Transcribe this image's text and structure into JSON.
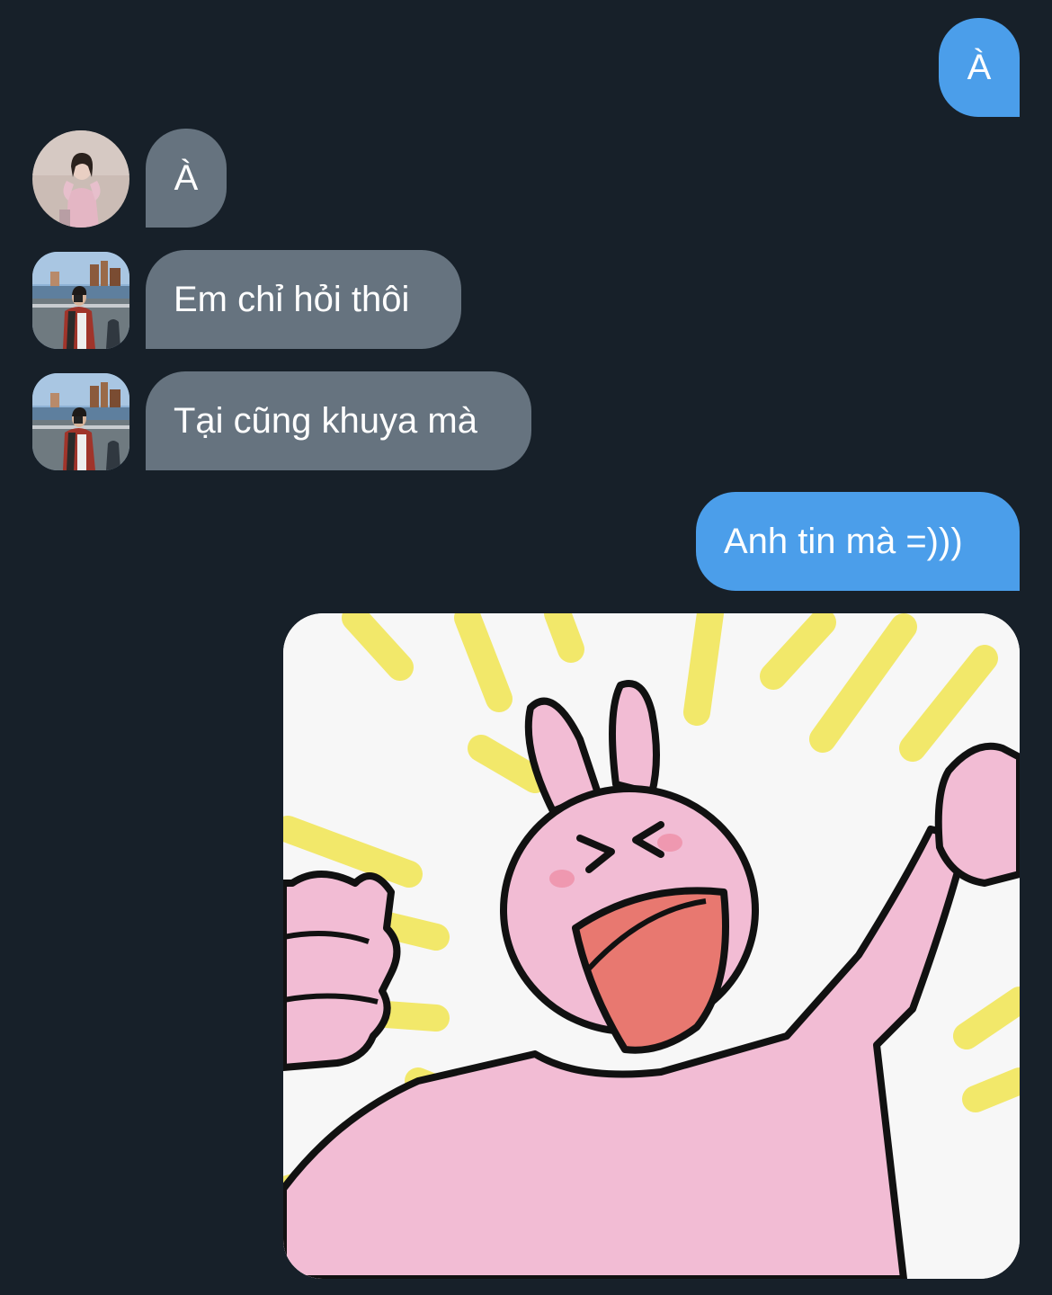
{
  "messages": [
    {
      "id": "m1",
      "direction": "outgoing",
      "text": "À"
    },
    {
      "id": "m2",
      "direction": "incoming",
      "text": "À",
      "avatar": "girl-avatar"
    },
    {
      "id": "m3",
      "direction": "incoming",
      "text": "Em chỉ hỏi thôi",
      "avatar": "boy-avatar"
    },
    {
      "id": "m4",
      "direction": "incoming",
      "text": "Tại cũng khuya mà",
      "avatar": "boy-avatar"
    },
    {
      "id": "m5",
      "direction": "outgoing",
      "text": "Anh tin mà =)))"
    },
    {
      "id": "m6",
      "direction": "outgoing",
      "type": "sticker",
      "sticker": "pink-rabbit-cheering-sticker"
    }
  ],
  "colors": {
    "background": "#172029",
    "incoming_bubble": "#66737f",
    "outgoing_bubble": "#4b9eea",
    "text": "#ffffff"
  }
}
